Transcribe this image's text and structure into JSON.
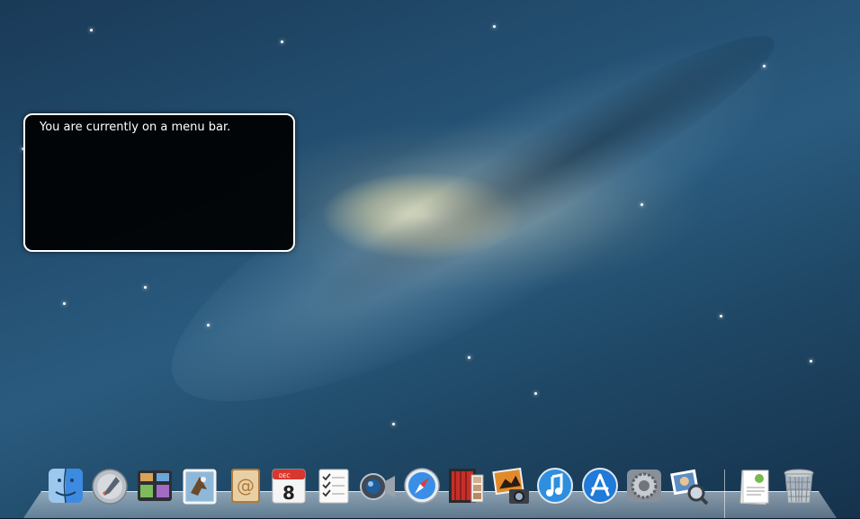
{
  "voiceover_caption": {
    "text": "You are currently on a menu bar."
  },
  "dock": {
    "items": [
      {
        "name": "Finder",
        "icon": "finder-icon"
      },
      {
        "name": "Launchpad",
        "icon": "launchpad-icon"
      },
      {
        "name": "Mission Control",
        "icon": "mission-control-icon"
      },
      {
        "name": "Mail",
        "icon": "mail-icon"
      },
      {
        "name": "Contacts",
        "icon": "contacts-icon"
      },
      {
        "name": "Calendar",
        "icon": "calendar-icon",
        "month": "DEC",
        "day": "8"
      },
      {
        "name": "Reminders",
        "icon": "reminders-icon"
      },
      {
        "name": "FaceTime",
        "icon": "facetime-icon"
      },
      {
        "name": "Safari",
        "icon": "safari-icon"
      },
      {
        "name": "Photo Booth",
        "icon": "photo-booth-icon"
      },
      {
        "name": "iPhoto",
        "icon": "iphoto-icon"
      },
      {
        "name": "iTunes",
        "icon": "itunes-icon"
      },
      {
        "name": "App Store",
        "icon": "app-store-icon"
      },
      {
        "name": "System Preferences",
        "icon": "system-preferences-icon"
      },
      {
        "name": "Preview",
        "icon": "preview-icon"
      },
      {
        "name": "Documents",
        "icon": "documents-stack-icon"
      },
      {
        "name": "Trash",
        "icon": "trash-icon"
      }
    ]
  }
}
